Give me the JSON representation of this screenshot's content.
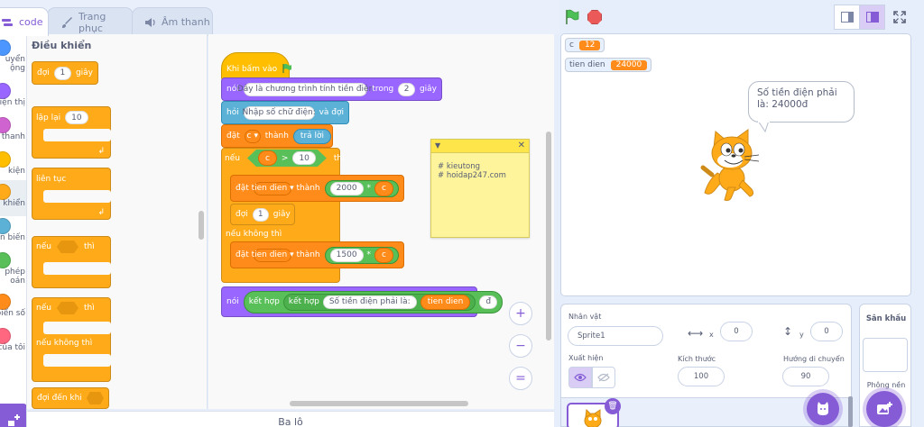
{
  "tabs": [
    {
      "label": "code"
    },
    {
      "label": "Trang phục"
    },
    {
      "label": "Âm thanh"
    }
  ],
  "categories": [
    {
      "label": "uyển\nộng",
      "color": "#4c97ff"
    },
    {
      "label": "iện thị",
      "color": "#9966ff"
    },
    {
      "label": "thanh",
      "color": "#cf63cf"
    },
    {
      "label": "kiện",
      "color": "#ffbf00"
    },
    {
      "label": "i khiển",
      "color": "#ffab19"
    },
    {
      "label": "n biến",
      "color": "#5cb1d6"
    },
    {
      "label": "phép\noán",
      "color": "#59c059"
    },
    {
      "label": "biến số",
      "color": "#ff8c1a"
    },
    {
      "label": "của tôi",
      "color": "#ff6680"
    }
  ],
  "palette": {
    "title": "Điều khiển",
    "wait_label": "đợi",
    "wait_value": "1",
    "wait_unit": "giây",
    "repeat_label": "lặp lại",
    "repeat_value": "10",
    "forever_label": "liên tục",
    "if_label": "nếu",
    "then_label": "thì",
    "if2_label": "nếu",
    "then2_label": "thì",
    "else_label": "nếu không thì",
    "wait_until_label": "đợi đến khi"
  },
  "script": {
    "hat_label": "Khi bấm vào",
    "say_label": "nói",
    "say_text": "Đây là chương trình tính tiền điện",
    "say_for": "trong",
    "say_secs": "2",
    "say_unit": "giây",
    "ask_label": "hỏi",
    "ask_text": "Nhập số chữ điện:",
    "ask_wait": "và đợi",
    "set1_label": "đặt",
    "set1_var": "c",
    "set1_to": "thành",
    "set1_value": "trả lời",
    "if_label": "nếu",
    "cond_var": "c",
    "cond_op": ">",
    "cond_value": "10",
    "then_label": "thì",
    "set2_label": "đặt",
    "set2_var": "tien dien",
    "set2_to": "thành",
    "set2_num": "2000",
    "set2_op": "*",
    "set2_rvar": "c",
    "wait_label": "đợi",
    "wait_value": "1",
    "wait_unit": "giây",
    "else_label": "nếu không thì",
    "set3_label": "đặt",
    "set3_var": "tien dien",
    "set3_to": "thành",
    "set3_num": "1500",
    "set3_op": "*",
    "set3_rvar": "c",
    "say2_label": "nói",
    "join1": "kết hợp",
    "join2": "kết hợp",
    "join_text": "Số tiền điện phải là:",
    "join_var": "tien dien",
    "join_suffix": "đ"
  },
  "note": {
    "text": "# kieutong\n# hoidap247.com"
  },
  "zoom": {
    "in": "+",
    "out": "−",
    "reset": "="
  },
  "backpack": {
    "label": "Ba lô"
  },
  "stage": {
    "monitor1_name": "c",
    "monitor1_value": "12",
    "monitor2_name": "tien dien",
    "monitor2_value": "24000",
    "bubble_text": "Số tiền điện phải là: 24000đ"
  },
  "sprite_info": {
    "title": "Nhân vật",
    "name": "Sprite1",
    "x_label": "x",
    "x_value": "0",
    "y_label": "y",
    "y_value": "0",
    "show_label": "Xuất hiện",
    "size_label": "Kích thước",
    "size_value": "100",
    "direction_label": "Hướng di chuyển",
    "direction_value": "90"
  },
  "stage_panel": {
    "title": "Sân khấu",
    "backdrops_label": "Phông nền"
  },
  "colors": {
    "accent": "#855cd6",
    "control": "#ffab19",
    "looks": "#9966ff",
    "sensing": "#5cb1d6",
    "variables": "#ff8c1a",
    "operators": "#59c059"
  }
}
